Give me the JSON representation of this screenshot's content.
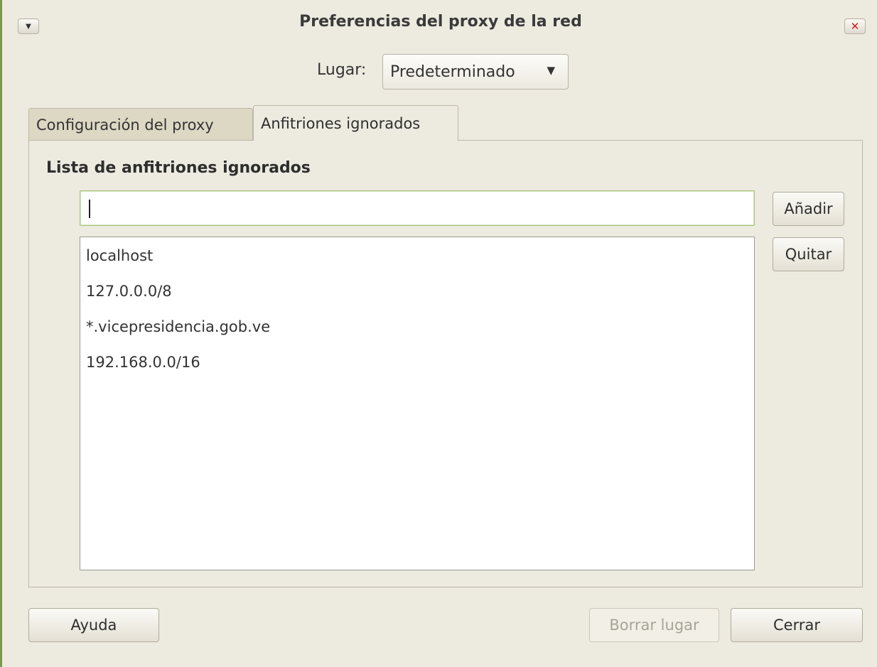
{
  "window": {
    "title": "Preferencias del proxy de la red",
    "menu_icon": "dropdown-arrow-icon",
    "close_icon": "close-icon"
  },
  "location": {
    "label": "Lugar:",
    "selected": "Predeterminado",
    "arrow": "▼"
  },
  "tabs": [
    {
      "label": "Configuración del proxy",
      "active": false
    },
    {
      "label": "Anfitriones ignorados",
      "active": true
    }
  ],
  "ignored": {
    "section_title": "Lista de anfitriones ignorados",
    "input_value": "",
    "add_label": "Añadir",
    "remove_label": "Quitar",
    "hosts": [
      "localhost",
      "127.0.0.0/8",
      "*.vicepresidencia.gob.ve",
      "192.168.0.0/16"
    ]
  },
  "footer": {
    "help_label": "Ayuda",
    "delete_location_label": "Borrar lugar",
    "close_label": "Cerrar"
  },
  "colors": {
    "window_bg": "#edeae0",
    "input_focus_border": "#a6c47f",
    "close_icon": "#d01818"
  }
}
